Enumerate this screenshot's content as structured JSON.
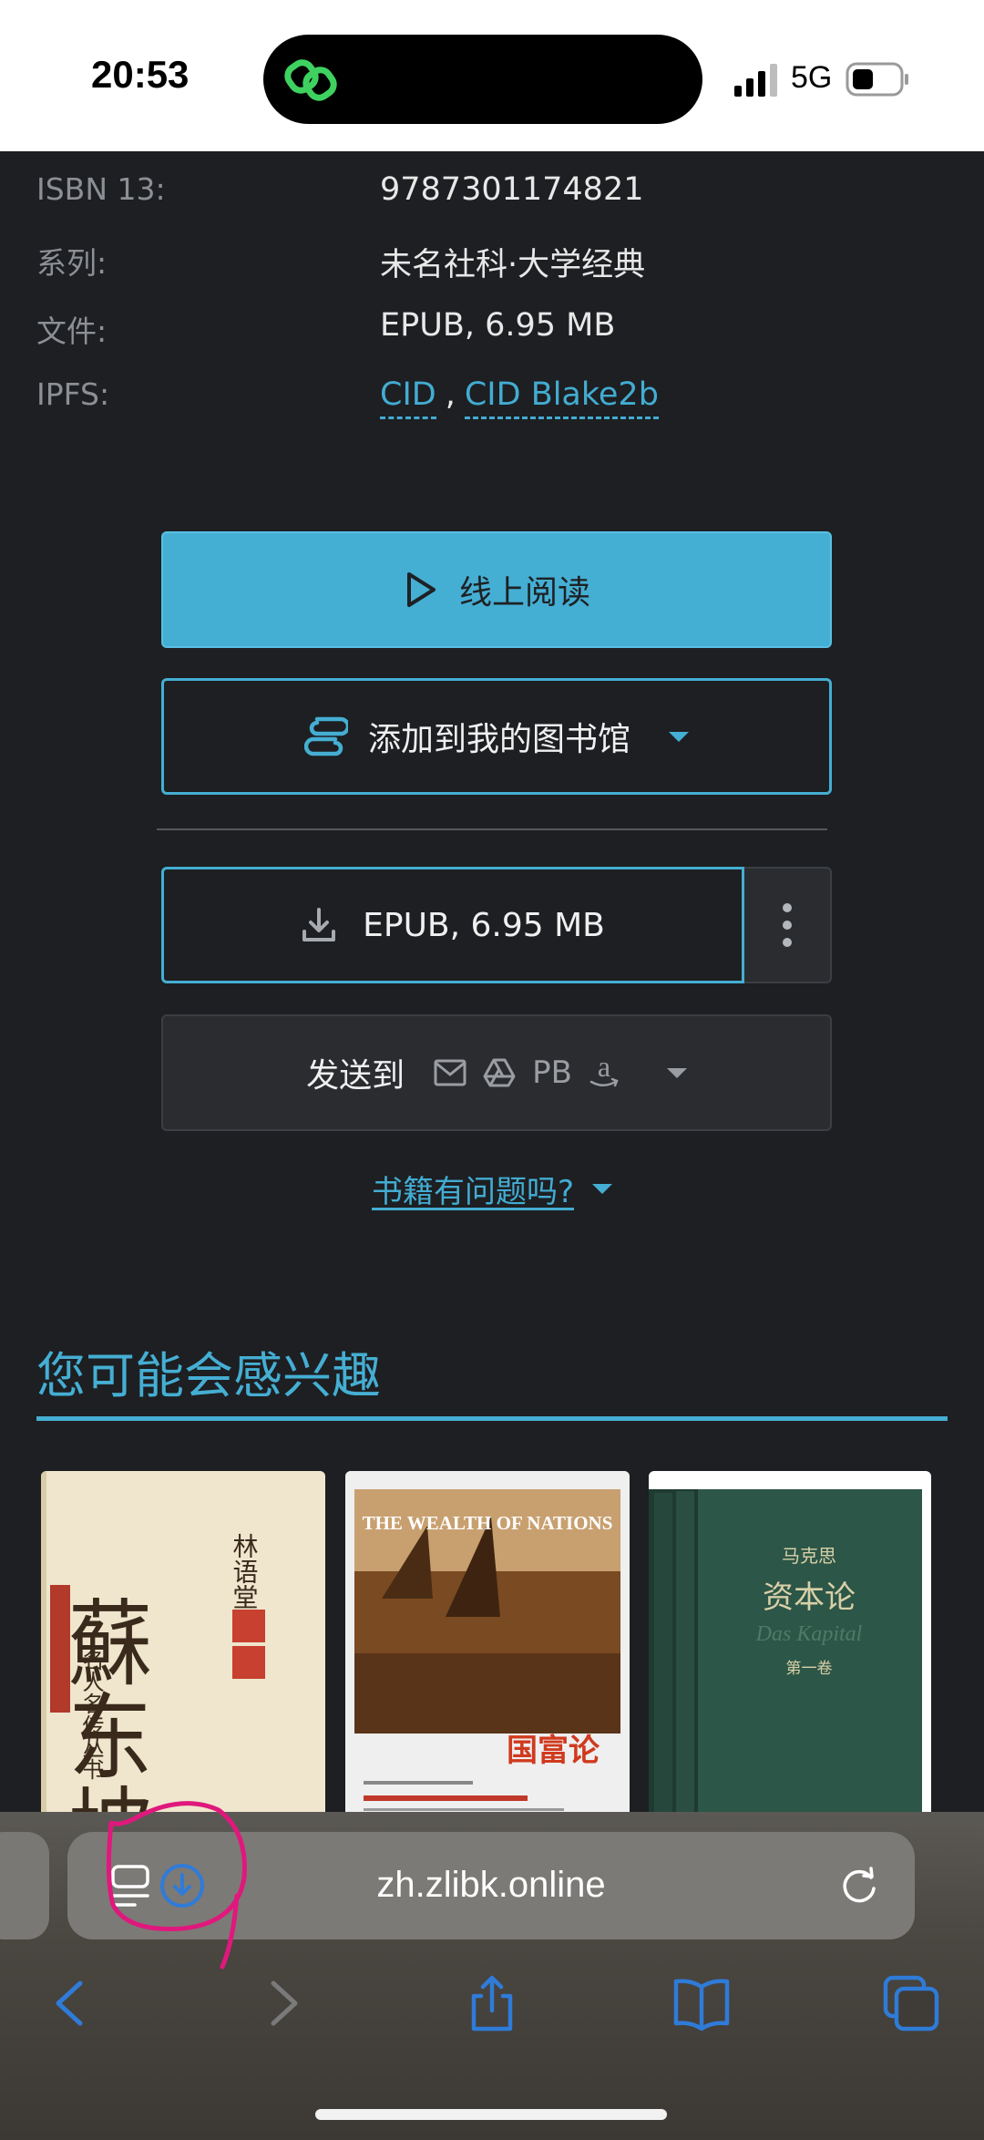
{
  "status_bar": {
    "time": "20:53",
    "network": "5G",
    "icons": [
      "app-chain-link-icon",
      "signal-icon",
      "battery-icon"
    ]
  },
  "details": [
    {
      "label": "ISBN 13:",
      "value": "9787301174821"
    },
    {
      "label": "系列:",
      "value": "未名社科·大学经典"
    },
    {
      "label": "文件:",
      "value": "EPUB, 6.95 MB"
    },
    {
      "label": "IPFS:",
      "links": [
        "CID",
        "CID Blake2b"
      ],
      "separator": ","
    }
  ],
  "actions": {
    "read_online": "线上阅读",
    "add_to_library": "添加到我的图书馆",
    "download": "EPUB, 6.95 MB",
    "send_to": "发送到",
    "send_pb": "PB",
    "book_problem": "书籍有问题吗?"
  },
  "recommended": {
    "title": "您可能会感兴趣",
    "books": [
      {
        "cover_text": [
          "蘇东坡",
          "林语堂",
          "名人名传丛书"
        ]
      },
      {
        "cover_text": [
          "THE WEALTH OF NATIONS",
          "国富论"
        ]
      },
      {
        "cover_text": [
          "马克思",
          "资本论",
          "Das Kapital",
          "第一卷"
        ]
      }
    ]
  },
  "browser": {
    "url": "zh.zlibk.online"
  },
  "colors": {
    "accent": "#45aed3",
    "background": "#1d1f22",
    "annotation": "#e0187d"
  }
}
